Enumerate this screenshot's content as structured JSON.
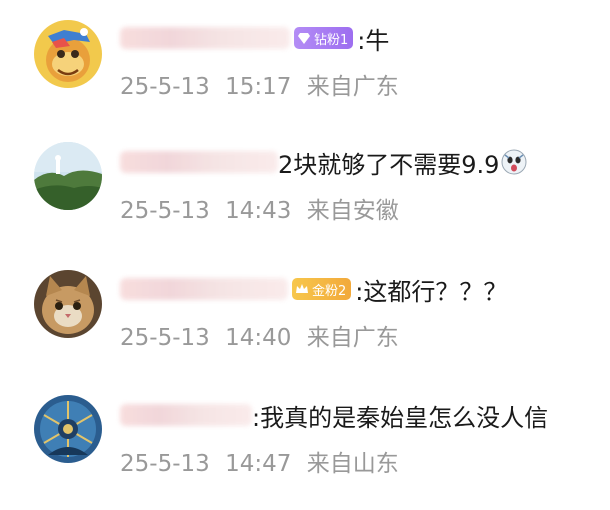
{
  "comments": [
    {
      "badge": "钻粉1",
      "text": ":牛",
      "date": "25-5-13",
      "time": "15:17",
      "location": "来自广东"
    },
    {
      "text": "2块就够了不需要9.9",
      "date": "25-5-13",
      "time": "14:43",
      "location": "来自安徽",
      "emoji_icon": "shocked-face-icon"
    },
    {
      "badge": "金粉2",
      "text": ":这都行？？？",
      "date": "25-5-13",
      "time": "14:40",
      "location": "来自广东"
    },
    {
      "text": ":我真的是秦始皇怎么没人信",
      "date": "25-5-13",
      "time": "14:47",
      "location": "来自山东"
    }
  ],
  "colors": {
    "meta_text": "#999999",
    "comment_text": "#1a1a1a",
    "badge_purple": "#a77bf3",
    "badge_gold": "#f4b442"
  }
}
